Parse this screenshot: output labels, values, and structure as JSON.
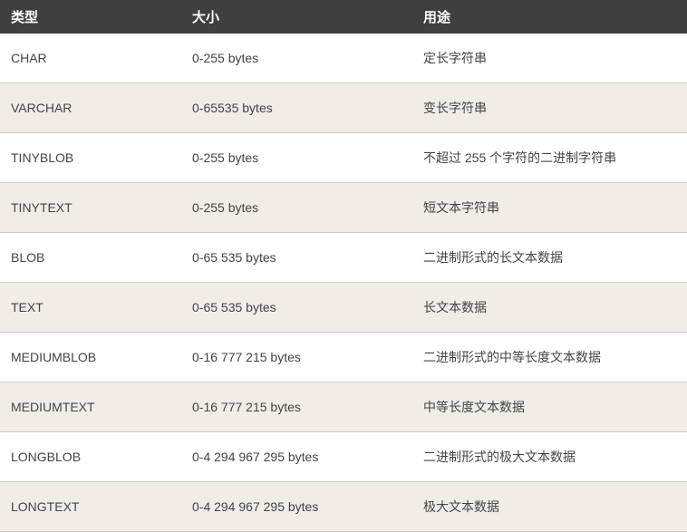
{
  "table": {
    "headers": {
      "type": "类型",
      "size": "大小",
      "usage": "用途"
    },
    "rows": [
      {
        "type": "CHAR",
        "size": "0-255 bytes",
        "usage": "定长字符串"
      },
      {
        "type": "VARCHAR",
        "size": "0-65535 bytes",
        "usage": "变长字符串"
      },
      {
        "type": "TINYBLOB",
        "size": "0-255 bytes",
        "usage": "不超过 255 个字符的二进制字符串"
      },
      {
        "type": "TINYTEXT",
        "size": "0-255 bytes",
        "usage": "短文本字符串"
      },
      {
        "type": "BLOB",
        "size": "0-65 535 bytes",
        "usage": "二进制形式的长文本数据"
      },
      {
        "type": "TEXT",
        "size": "0-65 535 bytes",
        "usage": "长文本数据"
      },
      {
        "type": "MEDIUMBLOB",
        "size": "0-16 777 215 bytes",
        "usage": "二进制形式的中等长度文本数据"
      },
      {
        "type": "MEDIUMTEXT",
        "size": "0-16 777 215 bytes",
        "usage": "中等长度文本数据"
      },
      {
        "type": "LONGBLOB",
        "size": "0-4 294 967 295 bytes",
        "usage": "二进制形式的极大文本数据"
      },
      {
        "type": "LONGTEXT",
        "size": "0-4 294 967 295 bytes",
        "usage": "极大文本数据"
      }
    ]
  }
}
